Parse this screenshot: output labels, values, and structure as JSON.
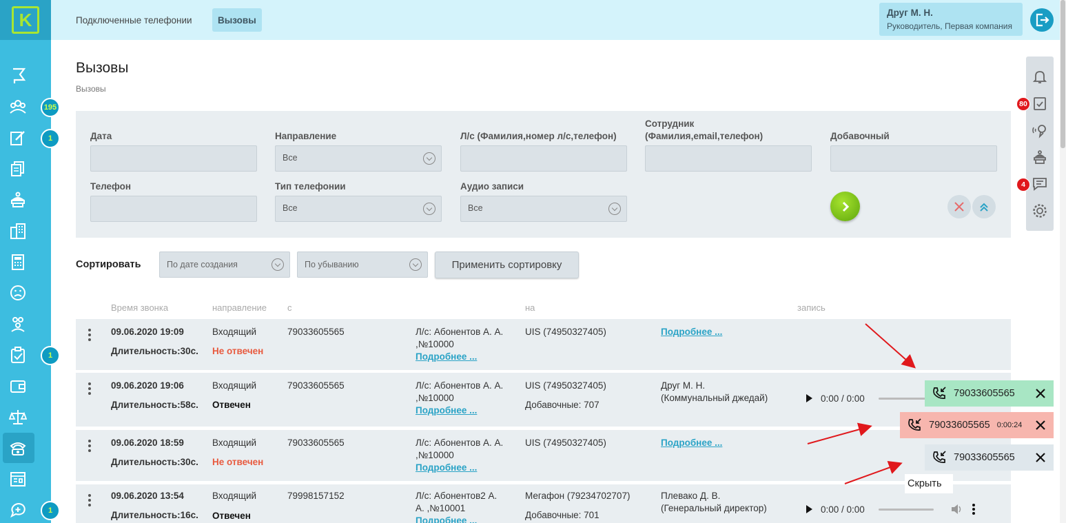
{
  "sidebar": {
    "logo_letter": "K",
    "badges": [
      "195",
      "1",
      "1",
      "1"
    ]
  },
  "topbar": {
    "nav": [
      "Подключенные телефонии",
      "Вызовы"
    ],
    "user_name": "Друг М. Н.",
    "user_role": "Руководитель, Первая компания"
  },
  "right_panel": {
    "badges": [
      "80",
      "4"
    ]
  },
  "page": {
    "title": "Вызовы",
    "breadcrumb": "Вызовы"
  },
  "filters": {
    "date_label": "Дата",
    "direction_label": "Направление",
    "direction_value": "Все",
    "account_label": "Л/с (Фамилия,номер л/с,телефон)",
    "employee_label_1": "Сотрудник",
    "employee_label_2": "(Фамилия,email,телефон)",
    "extension_label": "Добавочный",
    "phone_label": "Телефон",
    "telephony_type_label": "Тип телефонии",
    "telephony_type_value": "Все",
    "audio_label": "Аудио записи",
    "audio_value": "Все"
  },
  "sort": {
    "label": "Сортировать",
    "field_value": "По дате создания",
    "order_value": "По убыванию",
    "apply_label": "Применить сортировку"
  },
  "table": {
    "headers": [
      "Время звонка",
      "направление",
      "с",
      "на",
      "запись"
    ],
    "rows": [
      {
        "time": "09.06.2020 19:09",
        "duration": "Длительность:30с.",
        "direction": "Входящий",
        "status": "Не отвечен",
        "from": "79033605565",
        "account_1": "Л/с: Абонентов А. А.",
        "account_2": ",№10000",
        "account_link": "Подробнее ...",
        "to": "UIS (74950327405)",
        "to_extra": "",
        "employee_1": "",
        "employee_2": "",
        "employee_link": "Подробнее ..."
      },
      {
        "time": "09.06.2020 19:06",
        "duration": "Длительность:58с.",
        "direction": "Входящий",
        "status": "Отвечен",
        "from": "79033605565",
        "account_1": "Л/с: Абонентов А. А.",
        "account_2": ",№10000",
        "account_link": "Подробнее ...",
        "to": "UIS (74950327405)",
        "to_extra": "Добавочные: 707",
        "employee_1": "Друг М. Н.",
        "employee_2": "(Коммунальный джедай)",
        "employee_link": "",
        "player_time": "0:00 / 0:00"
      },
      {
        "time": "09.06.2020 18:59",
        "duration": "Длительность:30с.",
        "direction": "Входящий",
        "status": "Не отвечен",
        "from": "79033605565",
        "account_1": "Л/с: Абонентов А. А.",
        "account_2": ",№10000",
        "account_link": "Подробнее ...",
        "to": "UIS (74950327405)",
        "to_extra": "",
        "employee_1": "",
        "employee_2": "",
        "employee_link": "Подробнее ..."
      },
      {
        "time": "09.06.2020 13:54",
        "duration": "Длительность:16с.",
        "direction": "Входящий",
        "status": "Отвечен",
        "from": "79998157152",
        "account_1": "Л/с: Абонентов2 А.",
        "account_2": "А. ,№10001",
        "account_link": "Подробнее ...",
        "to": "Мегафон (79234702707)",
        "to_extra": "Добавочные: 701",
        "employee_1": "Плевако Д. В.",
        "employee_2": "(Генеральный директор)",
        "employee_link": "",
        "player_time": "0:00 / 0:00"
      }
    ]
  },
  "call_popups": [
    {
      "number": "79033605565",
      "timer": "",
      "color": "#a8e6c4"
    },
    {
      "number": "79033605565",
      "timer": "0:00:24",
      "color": "#f7b6ae"
    },
    {
      "number": "79033605565",
      "timer": "",
      "color": "#dfe7ec"
    }
  ],
  "hide_label": "Скрыть",
  "colors": {
    "sidebar": "#3dbde0",
    "accent_green": "#a8e632",
    "status_red": "#e85a3f",
    "link": "#2aa3c6"
  }
}
